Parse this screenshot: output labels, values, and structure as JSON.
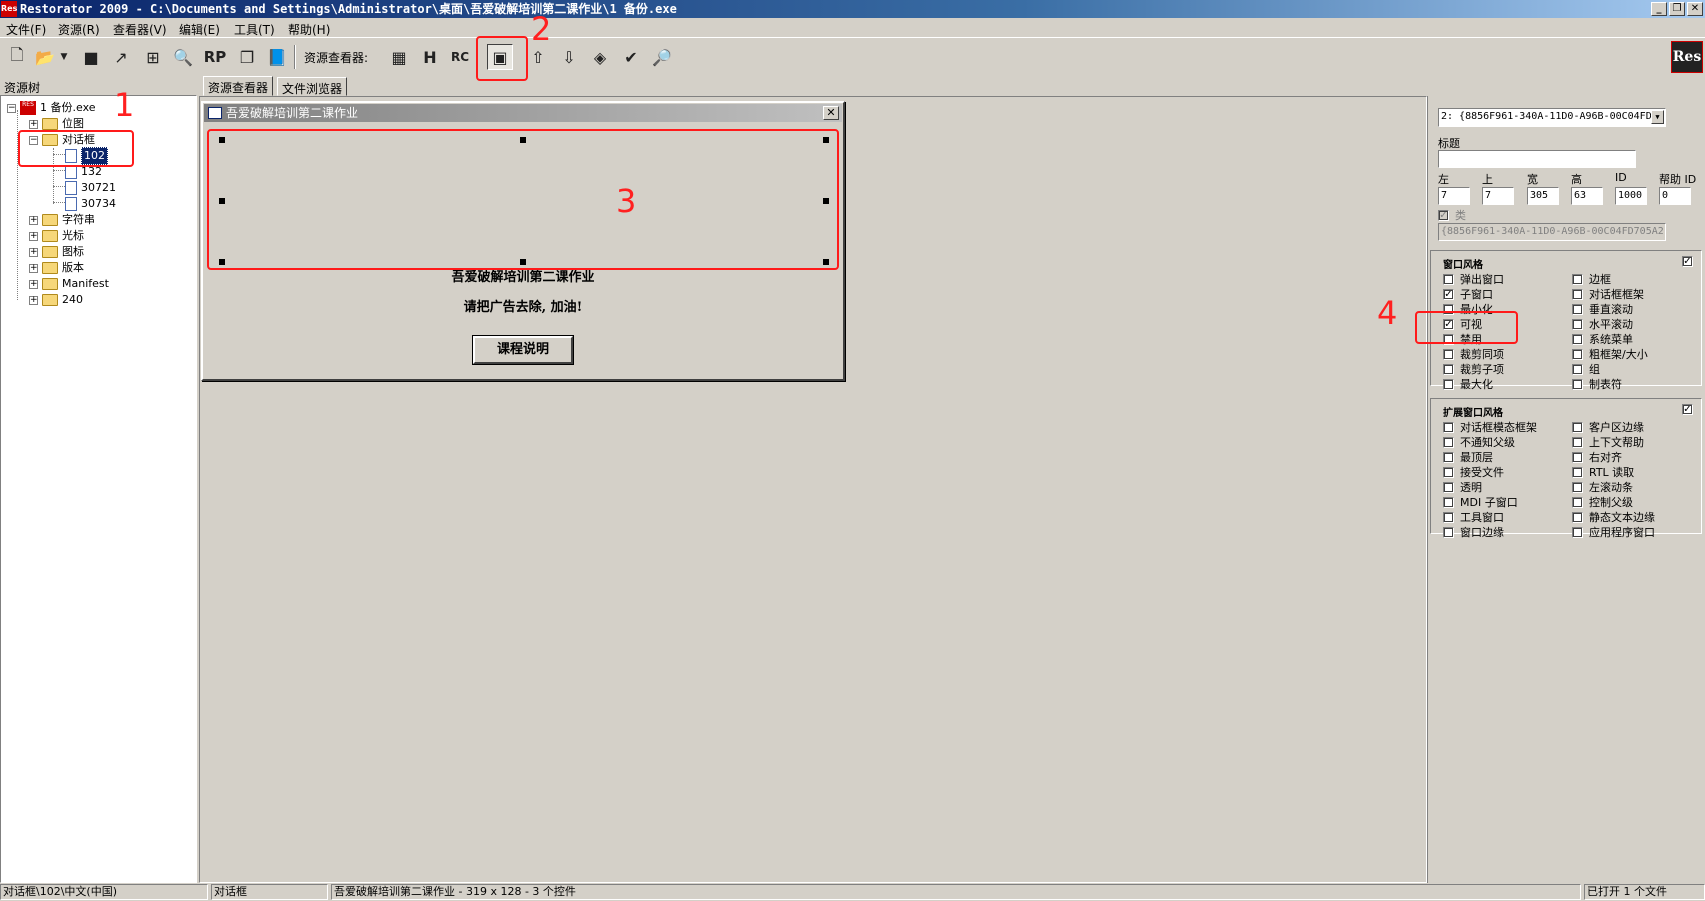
{
  "window": {
    "title": "Restorator 2009 - C:\\Documents and Settings\\Administrator\\桌面\\吾爱破解培训第二课作业\\1 备份.exe",
    "app_icon": "Res",
    "min": "_",
    "restore": "❐",
    "close": "✕"
  },
  "menu": [
    "文件(F)",
    "资源(R)",
    "查看器(V)",
    "编辑(E)",
    "工具(T)",
    "帮助(H)"
  ],
  "toolbar": {
    "viewer_label": "资源查看器:",
    "logo": "Res"
  },
  "annotations": [
    "1",
    "2",
    "3",
    "4"
  ],
  "tree": {
    "header": "资源树",
    "root": "1 备份.exe",
    "items": [
      "位图",
      "对话框",
      "102",
      "132",
      "30721",
      "30734",
      "字符串",
      "光标",
      "图标",
      "版本",
      "Manifest",
      "240"
    ]
  },
  "tabs": [
    "资源查看器",
    "文件浏览器"
  ],
  "dialog": {
    "title": "吾爱破解培训第二课作业",
    "close": "✕",
    "line1": "吾爱破解培训第二课作业",
    "line2": "请把广告去除, 加油!",
    "button": "课程说明"
  },
  "props": {
    "control_select": "2: {8856F961-340A-11D0-A96B-00C04FD",
    "title_label": "标题",
    "title_value": "",
    "labels": [
      "左",
      "上",
      "宽",
      "高",
      "ID",
      "帮助 ID"
    ],
    "values": [
      "7",
      "7",
      "305",
      "63",
      "1000",
      "0"
    ],
    "class_label": "类",
    "class_value": "{8856F961-340A-11D0-A96B-00C04FD705A2",
    "style_header": "窗口风格",
    "style_left": [
      {
        "label": "弹出窗口",
        "checked": ""
      },
      {
        "label": "子窗口",
        "checked": "✓"
      },
      {
        "label": "最小化",
        "checked": ""
      },
      {
        "label": "可视",
        "checked": "✓"
      },
      {
        "label": "禁用",
        "checked": ""
      },
      {
        "label": "裁剪同项",
        "checked": ""
      },
      {
        "label": "裁剪子项",
        "checked": ""
      },
      {
        "label": "最大化",
        "checked": ""
      }
    ],
    "style_right": [
      {
        "label": "边框",
        "checked": ""
      },
      {
        "label": "对话框框架",
        "checked": ""
      },
      {
        "label": "垂直滚动",
        "checked": ""
      },
      {
        "label": "水平滚动",
        "checked": ""
      },
      {
        "label": "系统菜单",
        "checked": ""
      },
      {
        "label": "粗框架/大小",
        "checked": ""
      },
      {
        "label": "组",
        "checked": ""
      },
      {
        "label": "制表符",
        "checked": ""
      }
    ],
    "exstyle_header": "扩展窗口风格",
    "exstyle_left": [
      {
        "label": "对话框模态框架",
        "checked": ""
      },
      {
        "label": "不通知父级",
        "checked": ""
      },
      {
        "label": "最顶层",
        "checked": ""
      },
      {
        "label": "接受文件",
        "checked": ""
      },
      {
        "label": "透明",
        "checked": ""
      },
      {
        "label": "MDI 子窗口",
        "checked": ""
      },
      {
        "label": "工具窗口",
        "checked": ""
      },
      {
        "label": "窗口边缘",
        "checked": ""
      }
    ],
    "exstyle_right": [
      {
        "label": "客户区边缘",
        "checked": ""
      },
      {
        "label": "上下文帮助",
        "checked": ""
      },
      {
        "label": "右对齐",
        "checked": ""
      },
      {
        "label": "RTL 读取",
        "checked": ""
      },
      {
        "label": "左滚动条",
        "checked": ""
      },
      {
        "label": "控制父级",
        "checked": ""
      },
      {
        "label": "静态文本边缘",
        "checked": ""
      },
      {
        "label": "应用程序窗口",
        "checked": ""
      }
    ]
  },
  "status": [
    "对话框\\102\\中文(中国)",
    "对话框",
    "吾爱破解培训第二课作业 - 319 x 128 - 3 个控件",
    "已打开 1 个文件"
  ]
}
